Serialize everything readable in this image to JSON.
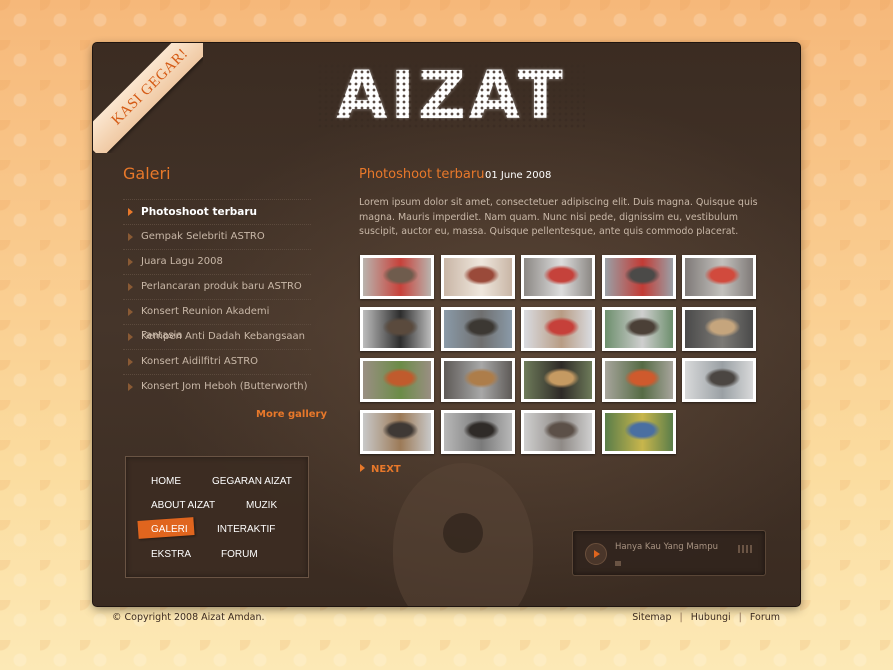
{
  "ribbon": {
    "text": "KASI GEGAR!"
  },
  "logo": {
    "text": "AIZAT"
  },
  "gallery": {
    "title": "Galeri",
    "items": [
      {
        "label": "Photoshoot terbaru",
        "active": true
      },
      {
        "label": "Gempak Selebriti ASTRO",
        "active": false
      },
      {
        "label": "Juara Lagu 2008",
        "active": false
      },
      {
        "label": "Perlancaran produk baru ASTRO",
        "active": false
      },
      {
        "label": "Konsert Reunion Akademi Fantasia",
        "active": false
      },
      {
        "label": "Kempen Anti Dadah Kebangsaan",
        "active": false
      },
      {
        "label": "Konsert Aidilfitri ASTRO",
        "active": false
      },
      {
        "label": "Konsert Jom Heboh (Butterworth)",
        "active": false
      }
    ],
    "more_label": "More gallery"
  },
  "nav": {
    "home": "HOME",
    "gegaran": "GEGARAN AIZAT",
    "about": "ABOUT AIZAT",
    "muzik": "MUZIK",
    "galeri": "GALERI",
    "interaktif": "INTERAKTIF",
    "ekstra": "EKSTRA",
    "forum": "FORUM",
    "active": "GALERI"
  },
  "content": {
    "title": "Photoshoot terbaru",
    "date": "01 June 2008",
    "text": "Lorem ipsum dolor sit amet, consectetuer adipiscing elit. Duis magna. Quisque quis magna. Mauris imperdiet. Nam quam. Nunc nisi pede, dignissim eu, vestibulum suscipit, auctor eu, massa. Quisque pellentesque, ante quis commodo placerat.",
    "thumbnail_count": 19,
    "next_label": "NEXT"
  },
  "player": {
    "track": "Hanya Kau Yang Mampu",
    "progress": 0.03
  },
  "footer": {
    "copyright": "© Copyright 2008 Aizat Amdan.",
    "links": [
      "Sitemap",
      "Hubungi",
      "Forum"
    ]
  },
  "colors": {
    "accent": "#e8782a",
    "panel": "#3a2b22",
    "nav_highlight": "#e0651e"
  }
}
